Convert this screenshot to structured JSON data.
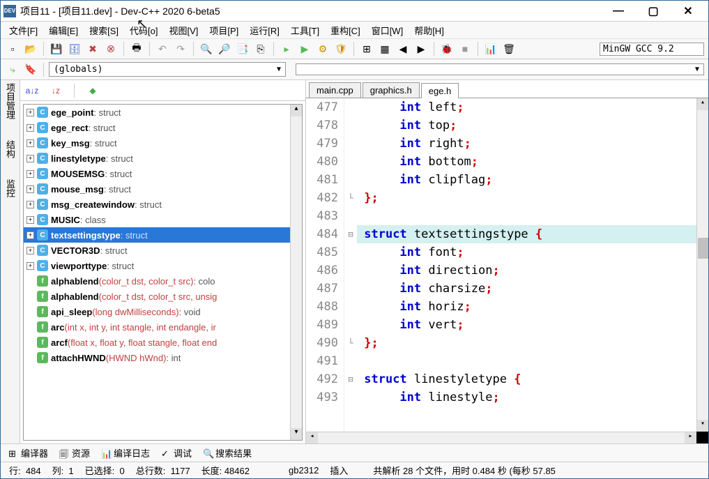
{
  "title": "项目11 - [项目11.dev] - Dev-C++ 2020 6-beta5",
  "menu": [
    "文件[F]",
    "编辑[E]",
    "搜索[S]",
    "代码[o]",
    "视图[V]",
    "项目[P]",
    "运行[R]",
    "工具[T]",
    "重构[C]",
    "窗口[W]",
    "帮助[H]"
  ],
  "compiler": "MinGW GCC 9.2",
  "scope_combo": "(globals)",
  "side_tabs": [
    "项目管理",
    "结构",
    "监控"
  ],
  "tree": [
    {
      "exp": "+",
      "icon": "C",
      "name": "ege_point",
      "type": ": struct"
    },
    {
      "exp": "+",
      "icon": "C",
      "name": "ege_rect",
      "type": ": struct"
    },
    {
      "exp": "+",
      "icon": "C",
      "name": "key_msg",
      "type": ": struct"
    },
    {
      "exp": "+",
      "icon": "C",
      "name": "linestyletype",
      "type": ": struct"
    },
    {
      "exp": "+",
      "icon": "C",
      "name": "MOUSEMSG",
      "type": ": struct"
    },
    {
      "exp": "+",
      "icon": "C",
      "name": "mouse_msg",
      "type": ": struct"
    },
    {
      "exp": "+",
      "icon": "C",
      "name": "msg_createwindow",
      "type": ": struct"
    },
    {
      "exp": "+",
      "icon": "C",
      "name": "MUSIC",
      "type": ": class"
    },
    {
      "exp": "+",
      "icon": "C",
      "name": "textsettingstype",
      "type": ": struct",
      "sel": true
    },
    {
      "exp": "+",
      "icon": "C",
      "name": "VECTOR3D",
      "type": ": struct"
    },
    {
      "exp": "+",
      "icon": "C",
      "name": "viewporttype",
      "type": ": struct"
    },
    {
      "exp": "",
      "icon": "f",
      "name": "alphablend",
      "args": "(color_t dst, color_t src)",
      "type": ":  colo"
    },
    {
      "exp": "",
      "icon": "f",
      "name": "alphablend",
      "args": "(color_t dst, color_t src, unsig",
      "type": ""
    },
    {
      "exp": "",
      "icon": "f",
      "name": "api_sleep",
      "args": "(long dwMilliseconds)",
      "type": ":  void"
    },
    {
      "exp": "",
      "icon": "f",
      "name": "arc",
      "args": "(int x, int y, int stangle, int endangle, ir",
      "type": ""
    },
    {
      "exp": "",
      "icon": "f",
      "name": "arcf",
      "args": "(float x, float y, float stangle, float end",
      "type": ""
    },
    {
      "exp": "",
      "icon": "f",
      "name": "attachHWND",
      "args": "(HWND hWnd)",
      "type": ":  int"
    }
  ],
  "editor_tabs": [
    "main.cpp",
    "graphics.h",
    "ege.h"
  ],
  "active_tab": 2,
  "code_start": 477,
  "hl_line": 484,
  "code": [
    {
      "t": "      ",
      "k": "int",
      "i": " left",
      "p": ";"
    },
    {
      "t": "      ",
      "k": "int",
      "i": " top",
      "p": ";"
    },
    {
      "t": "      ",
      "k": "int",
      "i": " right",
      "p": ";"
    },
    {
      "t": "      ",
      "k": "int",
      "i": " bottom",
      "p": ";"
    },
    {
      "t": "      ",
      "k": "int",
      "i": " clipflag",
      "p": ";"
    },
    {
      "t": " ",
      "p": "};",
      "fold": "└"
    },
    {
      "t": ""
    },
    {
      "t": " ",
      "k": "struct",
      "i": " textsettingstype ",
      "p": "{",
      "fold": "⊟"
    },
    {
      "t": "      ",
      "k": "int",
      "i": " font",
      "p": ";"
    },
    {
      "t": "      ",
      "k": "int",
      "i": " direction",
      "p": ";"
    },
    {
      "t": "      ",
      "k": "int",
      "i": " charsize",
      "p": ";"
    },
    {
      "t": "      ",
      "k": "int",
      "i": " horiz",
      "p": ";"
    },
    {
      "t": "      ",
      "k": "int",
      "i": " vert",
      "p": ";"
    },
    {
      "t": " ",
      "p": "};",
      "fold": "└"
    },
    {
      "t": ""
    },
    {
      "t": " ",
      "k": "struct",
      "i": " linestyletype ",
      "p": "{",
      "fold": "⊟"
    },
    {
      "t": "      ",
      "k": "int",
      "i": " linestyle",
      "p": ";"
    }
  ],
  "bottom_tabs": [
    {
      "i": "⊞",
      "l": "编译器"
    },
    {
      "i": "🗐",
      "l": "资源"
    },
    {
      "i": "📊",
      "l": "编译日志"
    },
    {
      "i": "✓",
      "l": "调试"
    },
    {
      "i": "🔍",
      "l": "搜索结果"
    }
  ],
  "status": {
    "row_l": "行:",
    "row": "484",
    "col_l": "列:",
    "col": "1",
    "sel_l": "已选择:",
    "sel": "0",
    "tot_l": "总行数:",
    "tot": "1177",
    "len_l": "长度:",
    "len": "48462",
    "enc": "gb2312",
    "ins": "插入",
    "parse": "共解析 28 个文件，用时 0.484 秒 (每秒 57.85"
  }
}
